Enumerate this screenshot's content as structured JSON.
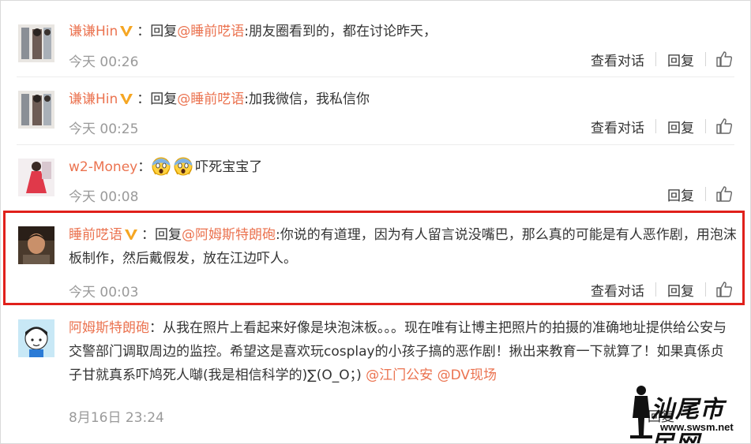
{
  "comments": [
    {
      "username": "谦谦Hin",
      "verified": true,
      "reply_prefix": "回复",
      "mention": "@睡前呓语",
      "body": ":朋友圈看到的，都在讨论昨天，",
      "time": "今天 00:26",
      "view_conversation": "查看对话",
      "reply": "回复"
    },
    {
      "username": "谦谦Hin",
      "verified": true,
      "reply_prefix": "回复",
      "mention": "@睡前呓语",
      "body": ":加我微信，我私信你",
      "time": "今天 00:25",
      "view_conversation": "查看对话",
      "reply": "回复"
    },
    {
      "username": "w2-Money",
      "verified": false,
      "emojis": [
        "scream-emoji",
        "scream-emoji"
      ],
      "body": "吓死宝宝了",
      "time": "今天 00:08",
      "reply": "回复"
    },
    {
      "username": "睡前呓语",
      "verified": true,
      "reply_prefix": "回复",
      "mention": "@阿姆斯特朗砲",
      "body": ":你说的有道理，因为有人留言说没嘴巴，那么真的可能是有人恶作剧，用泡沫板制作，然后戴假发，放在江边吓人。",
      "time": "今天 00:03",
      "view_conversation": "查看对话",
      "reply": "回复"
    },
    {
      "username": "阿姆斯特朗砲",
      "verified": false,
      "body": "：从我在照片上看起来好像是块泡沫板。。。现在唯有让博主把照片的拍摄的准确地址提供给公安与交警部门调取周边的监控。希望这是喜欢玩cosplay的小孩子搞的恶作剧！揪出来教育一下就算了！如果真係贞子甘就真系吓鸠死人嚹(我是相信科学的)∑(O_O；) ",
      "mention_1": "@江门公安",
      "mention_2": "@DV现场",
      "time": "8月16日 23:24",
      "reply": "回复"
    }
  ],
  "watermark": {
    "cn": "汕尾市民网",
    "url": "www.swsm.net"
  },
  "colors": {
    "username": "#eb7350",
    "meta": "#9a9a9a",
    "highlight_border": "#e0201b",
    "verified_badge": "#f5a623"
  }
}
